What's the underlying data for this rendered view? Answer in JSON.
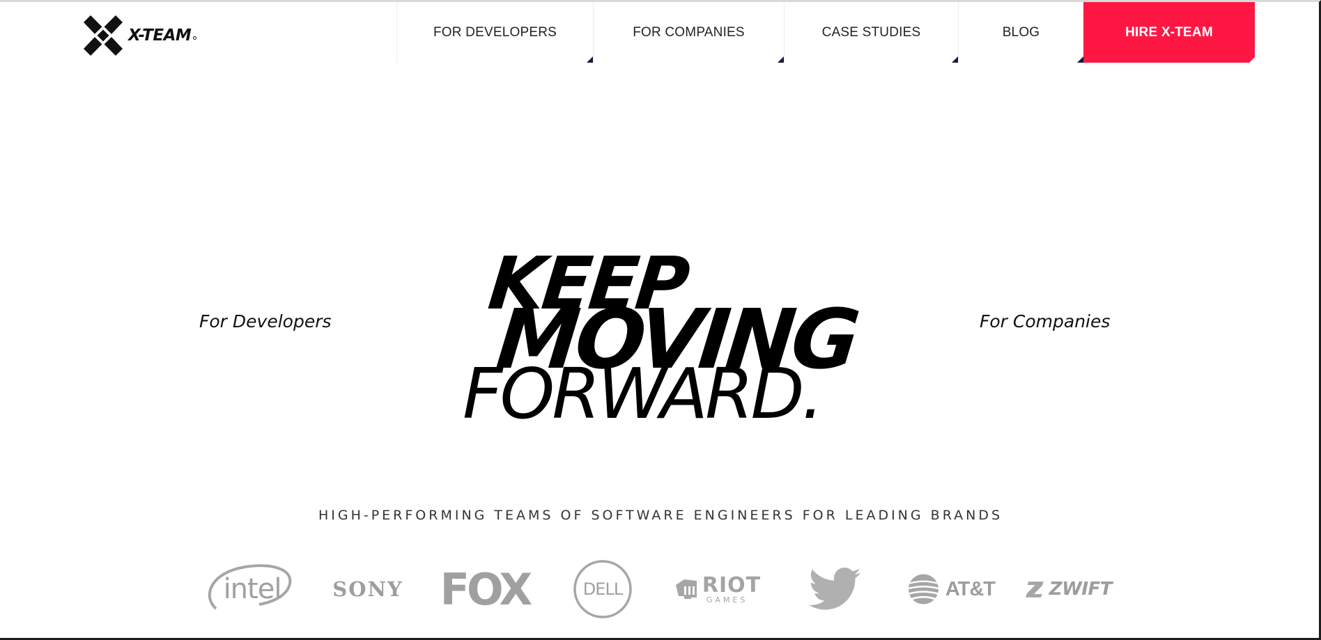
{
  "header": {
    "logo_text": "X-TEAM",
    "nav": [
      {
        "label": "FOR DEVELOPERS"
      },
      {
        "label": "FOR COMPANIES"
      },
      {
        "label": "CASE STUDIES"
      },
      {
        "label": "BLOG"
      },
      {
        "label": "HIRE X-TEAM"
      }
    ],
    "accent_color": "#ff1744"
  },
  "hero": {
    "left_link": "For Developers",
    "right_link": "For Companies",
    "headline_line1": "KEEP",
    "headline_line2": "MOVING",
    "headline_line3": "FORWARD."
  },
  "brands": {
    "tagline": "HIGH-PERFORMING TEAMS OF SOFTWARE ENGINEERS FOR LEADING BRANDS",
    "logos": [
      {
        "name": "intel",
        "text": "intel",
        "icon": "intel-logo"
      },
      {
        "name": "sony",
        "text": "SONY",
        "icon": "sony-logo"
      },
      {
        "name": "fox",
        "text": "FOX",
        "icon": "fox-logo"
      },
      {
        "name": "dell",
        "text": "DELL",
        "icon": "dell-logo"
      },
      {
        "name": "riot",
        "text": "RIOT",
        "subtext": "GAMES",
        "icon": "riot-games-logo"
      },
      {
        "name": "twitter",
        "text": "",
        "icon": "twitter-bird-icon"
      },
      {
        "name": "att",
        "text": "AT&T",
        "icon": "att-globe-logo"
      },
      {
        "name": "zwift",
        "text": "ZWIFT",
        "icon": "zwift-logo"
      }
    ]
  }
}
